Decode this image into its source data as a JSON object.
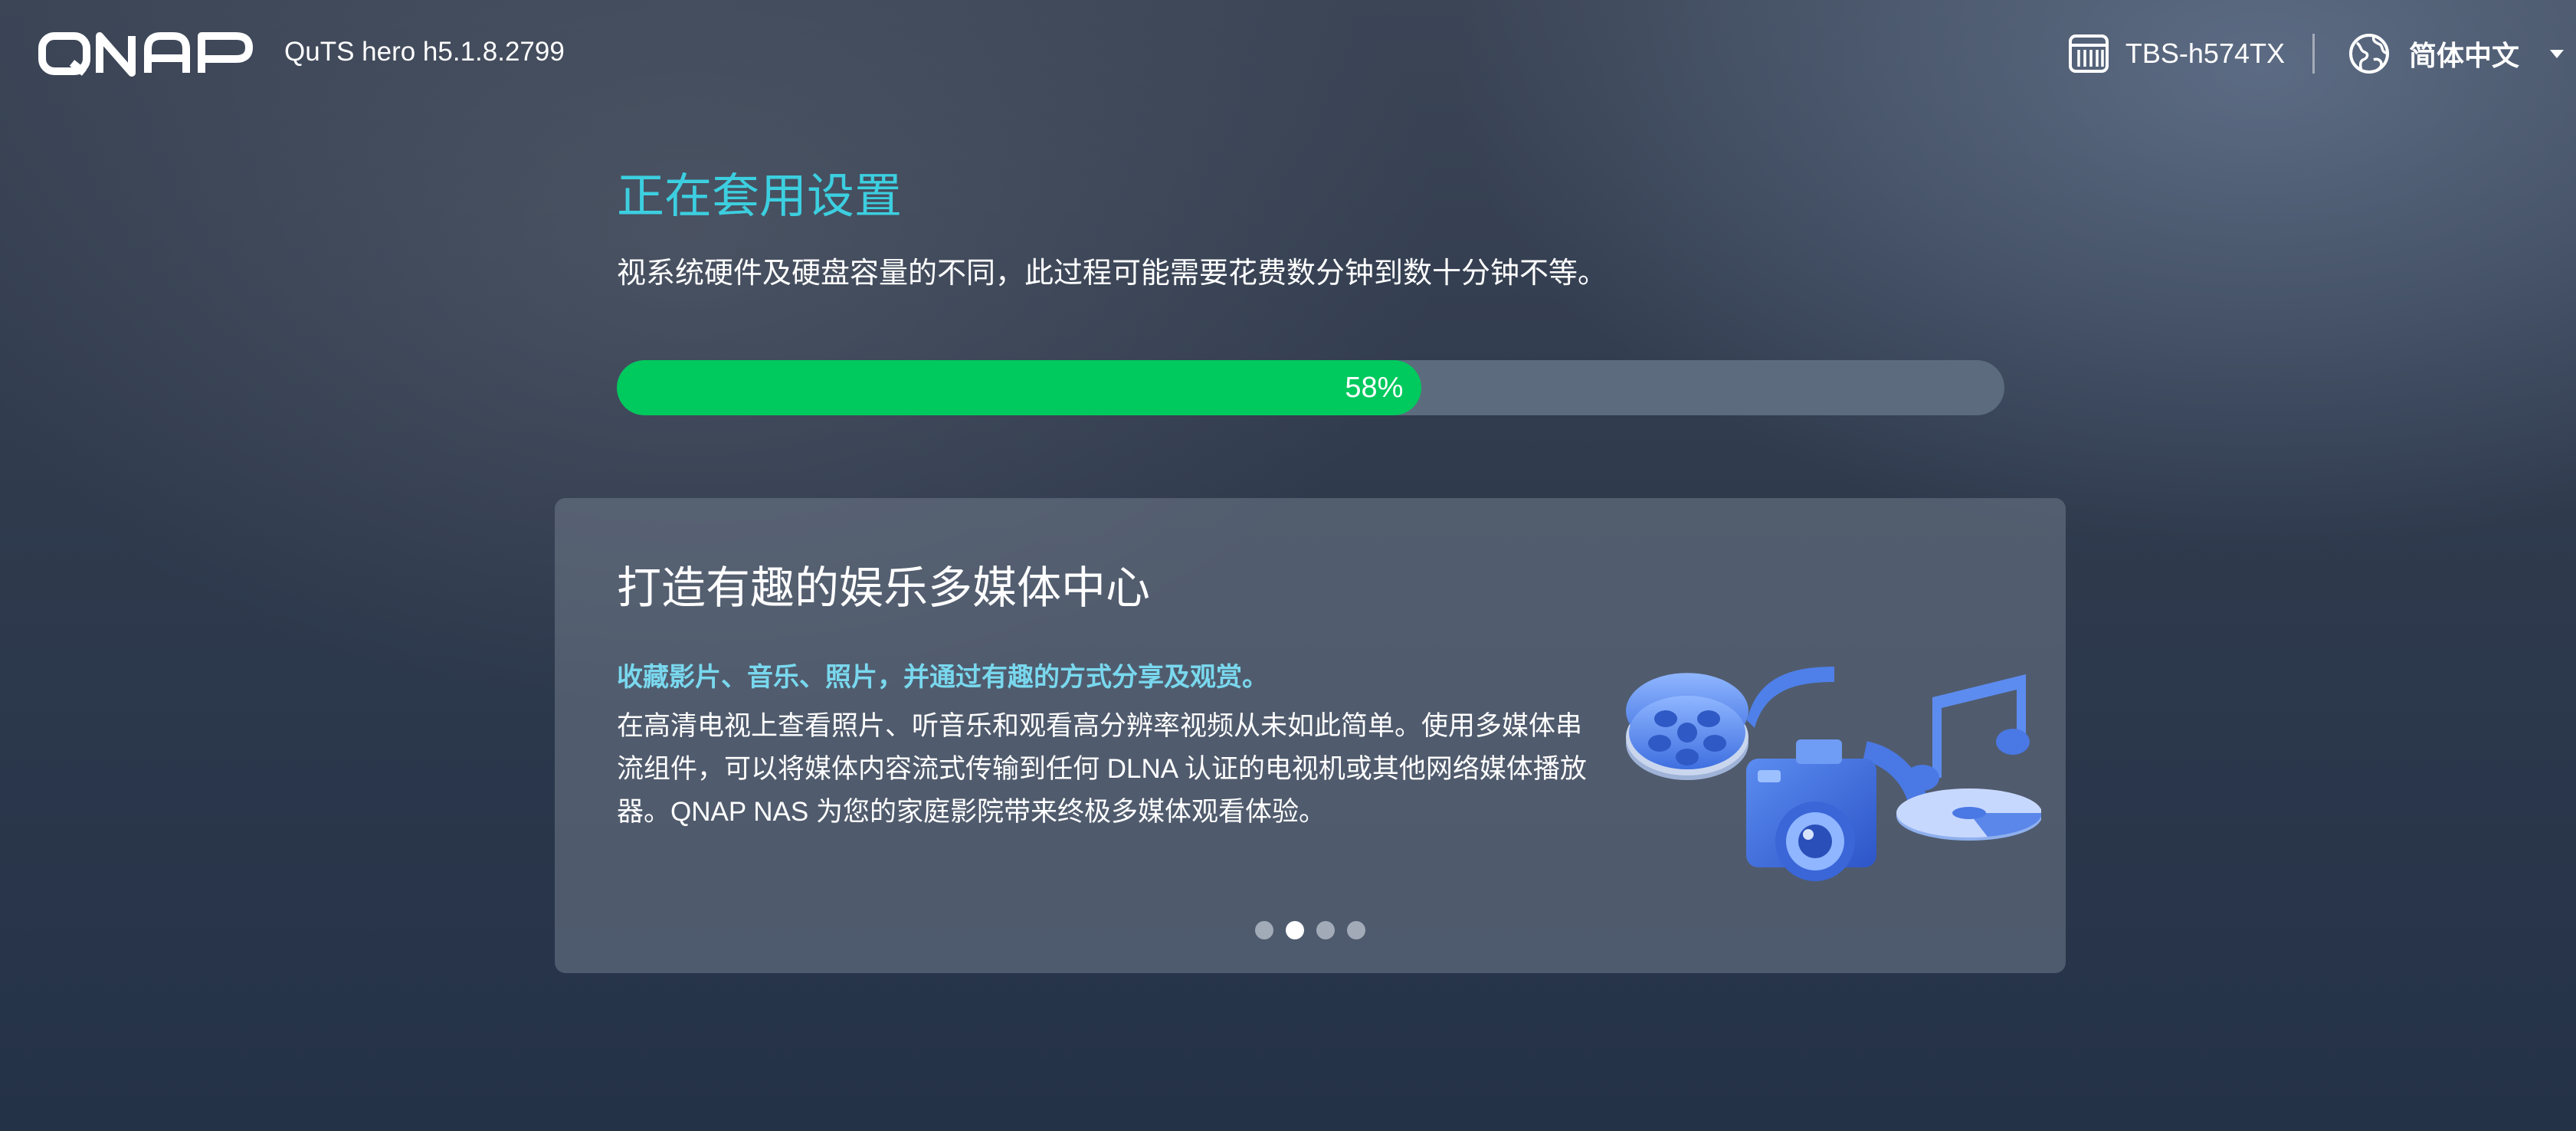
{
  "header": {
    "version": "QuTS hero h5.1.8.2799",
    "device_name": "TBS-h574TX",
    "language": "简体中文"
  },
  "main": {
    "title": "正在套用设置",
    "subtitle": "视系统硬件及硬盘容量的不同，此过程可能需要花费数分钟到数十分钟不等。",
    "progress": {
      "label": "58%",
      "percent": 58
    }
  },
  "card": {
    "title": "打造有趣的娱乐多媒体中心",
    "highlight": "收藏影片、音乐、照片，并通过有趣的方式分享及观赏。",
    "body": "在高清电视上查看照片、听音乐和观看高分辨率视频从未如此简单。使用多媒体串流组件，可以将媒体内容流式传输到任何 DLNA 认证的电视机或其他网络媒体播放器。QNAP NAS 为您的家庭影院带来终极多媒体观看体验。",
    "carousel": {
      "count": 4,
      "active_index": 1
    }
  },
  "colors": {
    "accent_title": "#3ccfe0",
    "progress_fill": "#00c95d",
    "progress_track": "#5d6b7e",
    "highlight": "#79d8ee"
  },
  "icons": {
    "logo": "qnap-logo",
    "device": "nas-device-icon",
    "language": "globe-icon",
    "dropdown": "caret-down-icon",
    "illustration": "multimedia-illustration"
  }
}
